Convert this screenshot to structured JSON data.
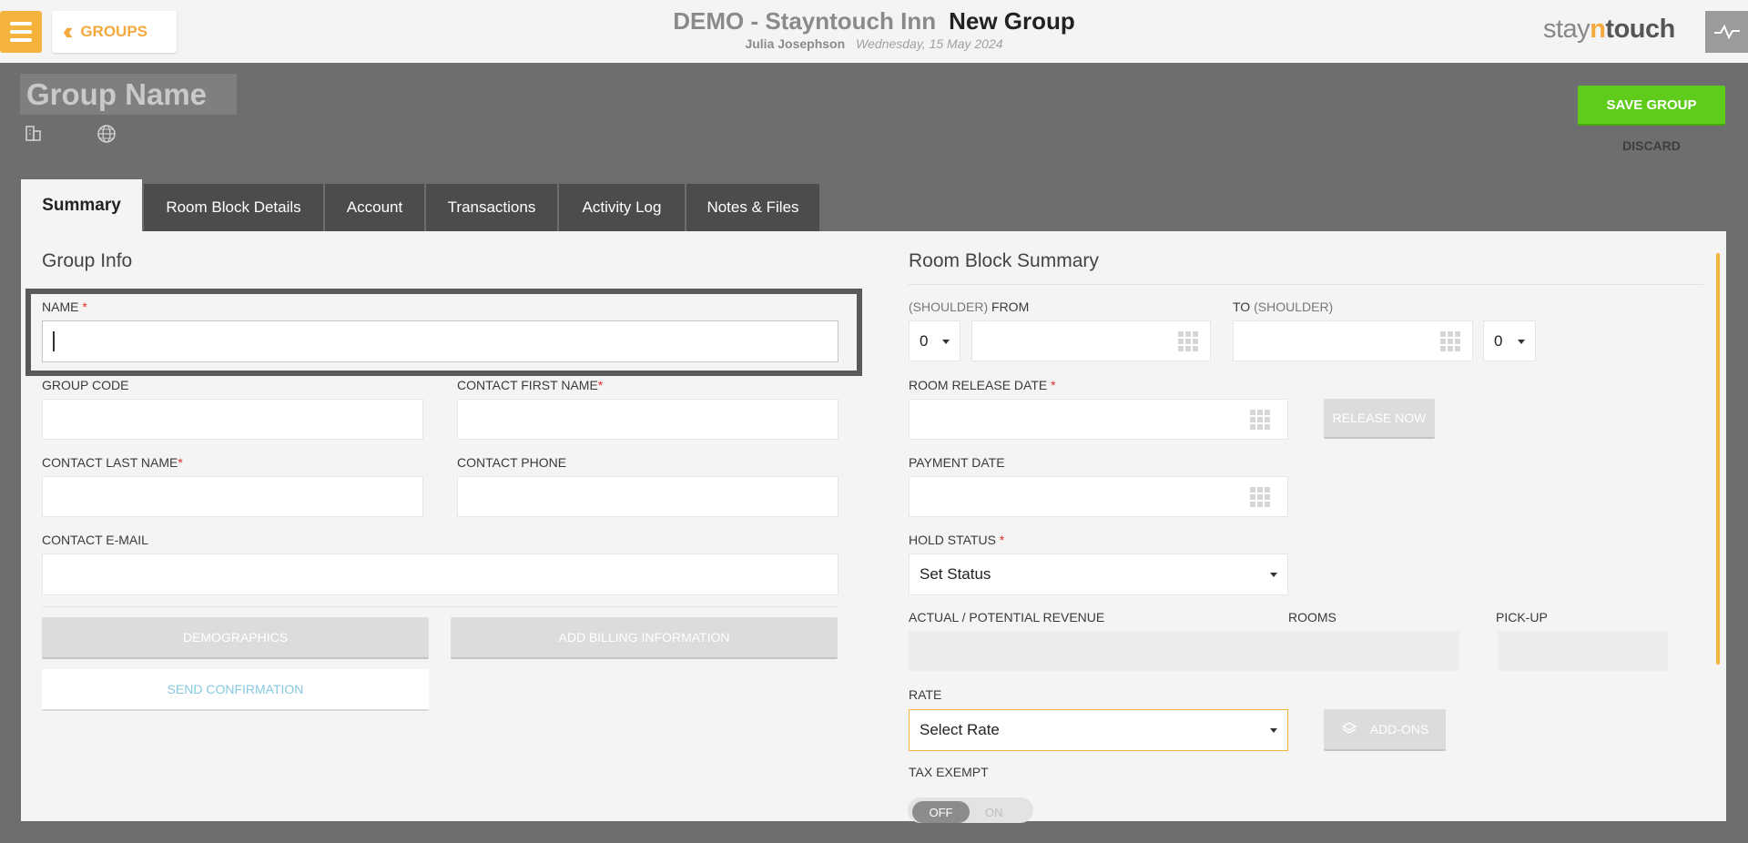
{
  "header": {
    "back_label": "GROUPS",
    "hotel": "DEMO - Stayntouch Inn",
    "page_title": "New Group",
    "user": "Julia Josephson",
    "date": "Wednesday, 15 May 2024",
    "logo": {
      "part1": "stay",
      "part2": "n",
      "part3": "touch"
    }
  },
  "title_area": {
    "group_name_placeholder": "Group Name",
    "save_label": "SAVE GROUP",
    "discard_label": "DISCARD"
  },
  "tabs": [
    {
      "label": "Summary",
      "active": true
    },
    {
      "label": "Room Block Details"
    },
    {
      "label": "Account"
    },
    {
      "label": "Transactions"
    },
    {
      "label": "Activity Log"
    },
    {
      "label": "Notes & Files"
    }
  ],
  "group_info": {
    "title": "Group Info",
    "name_label": "NAME",
    "name_value": "",
    "group_code_label": "GROUP CODE",
    "contact_first_label": "CONTACT FIRST NAME",
    "contact_last_label": "CONTACT LAST NAME",
    "contact_phone_label": "CONTACT PHONE",
    "contact_email_label": "CONTACT E-MAIL",
    "demographics_label": "DEMOGRAPHICS",
    "billing_label": "ADD BILLING INFORMATION",
    "send_confirmation_label": "SEND CONFIRMATION",
    "required_mark": "*"
  },
  "room_block": {
    "title": "Room Block Summary",
    "from_shoulder": "(SHOULDER)",
    "from_label": "FROM",
    "to_label": "TO",
    "to_shoulder": "(SHOULDER)",
    "shoulder_from_value": "0",
    "shoulder_to_value": "0",
    "release_date_label": "ROOM RELEASE DATE",
    "release_now_label": "RELEASE NOW",
    "payment_date_label": "PAYMENT DATE",
    "hold_status_label": "HOLD STATUS",
    "hold_status_value": "Set Status",
    "revenue_label": "ACTUAL / POTENTIAL REVENUE",
    "rooms_label": "ROOMS",
    "pickup_label": "PICK-UP",
    "rate_label": "RATE",
    "rate_value": "Select Rate",
    "addons_label": "ADD-ONS",
    "tax_exempt_label": "TAX EXEMPT",
    "toggle_off": "OFF",
    "toggle_on": "ON"
  },
  "icons": [
    "menu-icon",
    "double-chevron-left-icon",
    "pulse-icon",
    "building-icon",
    "globe-icon",
    "calendar-icon",
    "layers-icon"
  ],
  "colors": {
    "accent_orange": "#f3b33d",
    "save_green": "#5fcb1a",
    "required_red": "#e0312a",
    "link_blue": "#87c9e0",
    "background_grey": "#6d6e70"
  }
}
